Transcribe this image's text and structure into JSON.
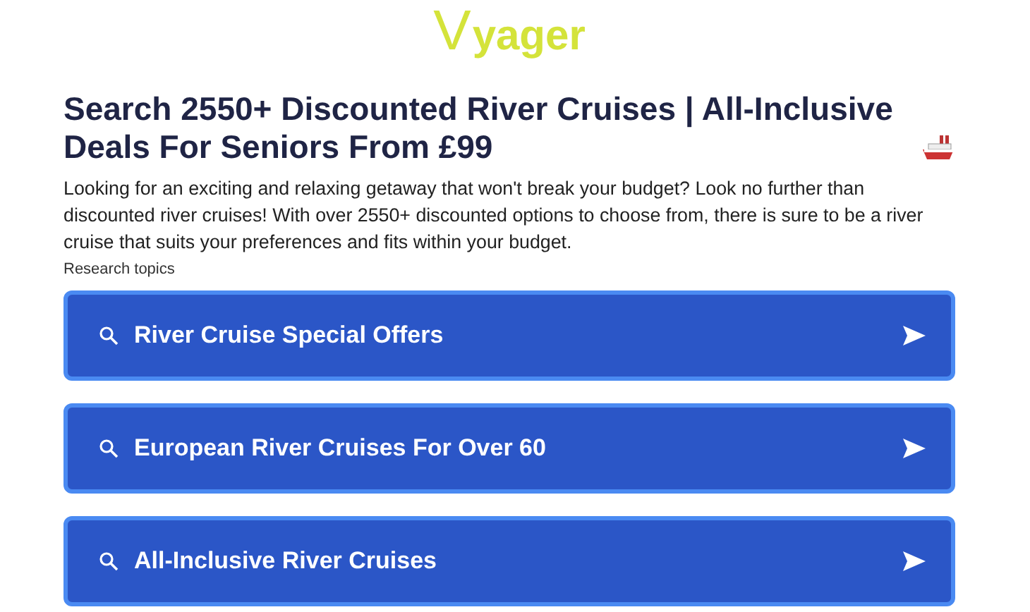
{
  "logo": "Vyager",
  "title": "Search 2550+ Discounted River Cruises | All-Inclusive Deals For Seniors From £99",
  "intro": "Looking for an exciting and relaxing getaway that won't break your budget? Look no further than discounted river cruises! With over 2550+ discounted options to choose from, there is sure to be a river cruise that suits your preferences and fits within your budget.",
  "topics_label": "Research topics",
  "topics": [
    {
      "label": "River Cruise Special Offers"
    },
    {
      "label": "European River Cruises For Over 60"
    },
    {
      "label": "All-Inclusive River Cruises"
    }
  ]
}
